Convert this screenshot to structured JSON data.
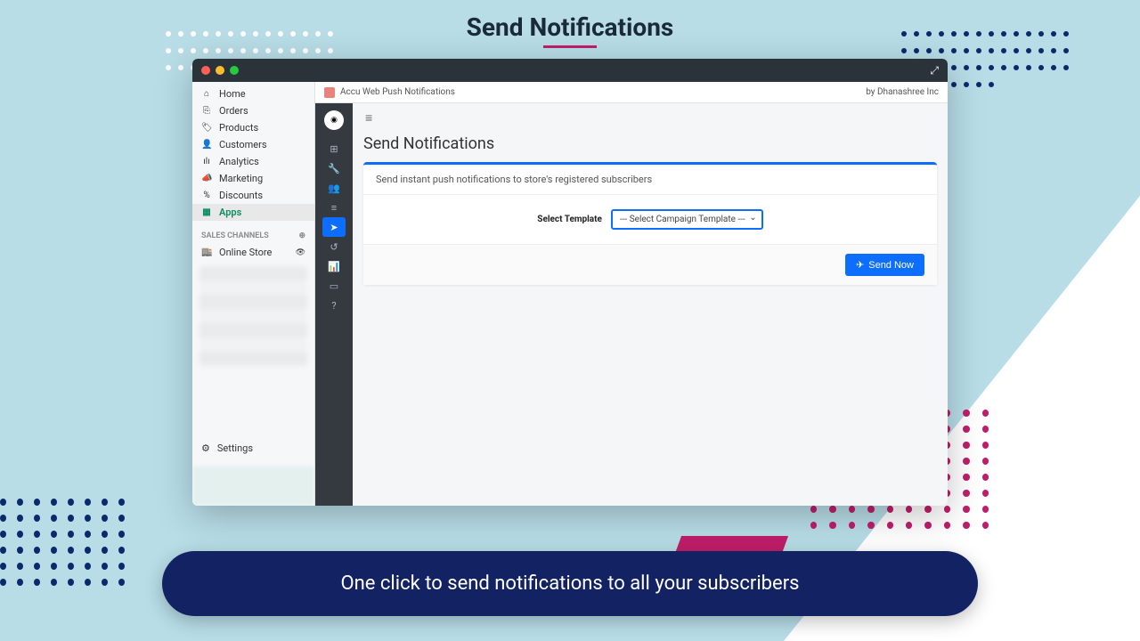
{
  "page_title": "Send Notifications",
  "bottom_banner": "One click to send notifications to all your subscribers",
  "window": {
    "app_name": "Accu Web Push Notifications",
    "vendor": "by Dhanashree Inc"
  },
  "shopify_nav": {
    "items": [
      {
        "label": "Home",
        "icon": "⌂"
      },
      {
        "label": "Orders",
        "icon": "⎘"
      },
      {
        "label": "Products",
        "icon": "🏷"
      },
      {
        "label": "Customers",
        "icon": "👤"
      },
      {
        "label": "Analytics",
        "icon": "ılı"
      },
      {
        "label": "Marketing",
        "icon": "📣"
      },
      {
        "label": "Discounts",
        "icon": "%"
      },
      {
        "label": "Apps",
        "icon": "▦"
      }
    ],
    "sales_channels_label": "SALES CHANNELS",
    "online_store": "Online Store",
    "settings": "Settings"
  },
  "icon_sidebar": {
    "items": [
      {
        "name": "grid-icon",
        "glyph": "⊞"
      },
      {
        "name": "wrench-icon",
        "glyph": "🔧"
      },
      {
        "name": "users-icon",
        "glyph": "👥"
      },
      {
        "name": "list-icon",
        "glyph": "≡"
      },
      {
        "name": "send-icon",
        "glyph": "➤",
        "active": true
      },
      {
        "name": "history-icon",
        "glyph": "↺"
      },
      {
        "name": "chart-icon",
        "glyph": "📊"
      },
      {
        "name": "card-icon",
        "glyph": "▭"
      },
      {
        "name": "help-icon",
        "glyph": "?"
      }
    ]
  },
  "main": {
    "title": "Send Notifications",
    "info": "Send instant push notifications to store's registered subscribers",
    "select_label": "Select Template",
    "select_placeholder": "--- Select Campaign Template ---",
    "send_button": "Send Now"
  }
}
